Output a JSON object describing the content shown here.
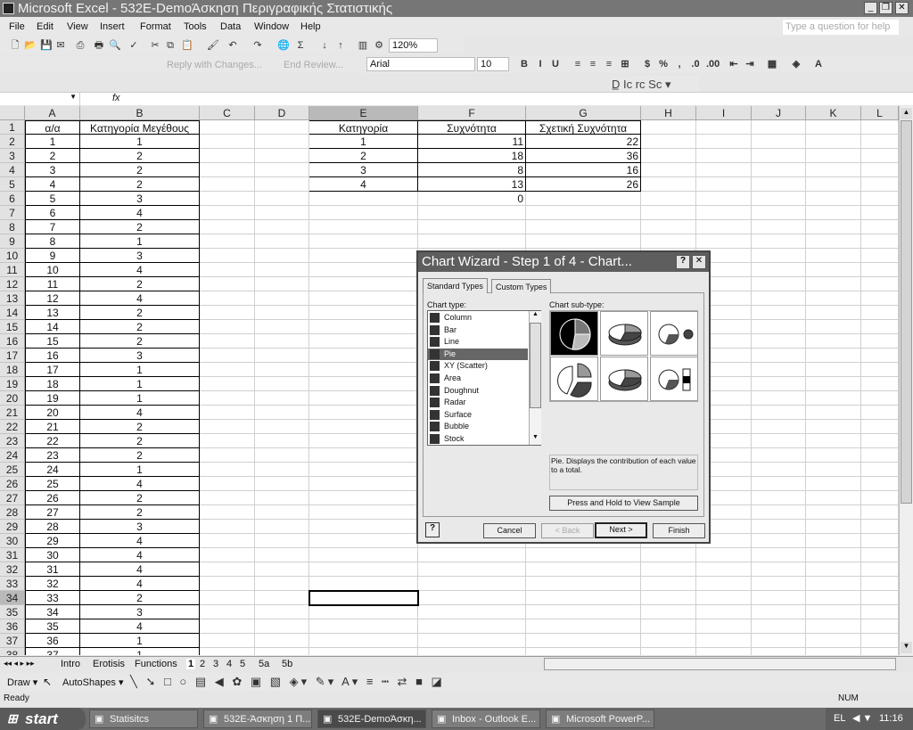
{
  "window": {
    "title": "Microsoft Excel - 532E-DemoΆσκηση Περιγραφικής Στατιστικής"
  },
  "menu": [
    "File",
    "Edit",
    "View",
    "Insert",
    "Format",
    "Tools",
    "Data",
    "Window",
    "Help"
  ],
  "help_placeholder": "Type a question for help",
  "toolbar": {
    "zoom": "120%",
    "reply_label": "Reply with Changes...",
    "end_review_label": "End Review...",
    "font": "Arial",
    "font_size": "10"
  },
  "columns": [
    "A",
    "B",
    "C",
    "D",
    "E",
    "F",
    "G",
    "H",
    "I",
    "J",
    "K",
    "L"
  ],
  "sheet": {
    "A_header": "α/α",
    "B_header": "Κατηγορία Μεγέθους",
    "B_values": [
      1,
      2,
      2,
      2,
      3,
      4,
      2,
      1,
      3,
      4,
      2,
      4,
      2,
      2,
      2,
      3,
      1,
      1,
      1,
      4,
      2,
      2,
      2,
      1,
      4,
      2,
      2,
      3,
      4,
      4,
      4,
      4,
      2,
      3,
      4,
      1,
      1
    ],
    "freq_headers": [
      "Κατηγορία",
      "Συχνότητα",
      "Σχετική Συχνότητα"
    ],
    "freq_rows": [
      [
        1,
        11,
        22
      ],
      [
        2,
        18,
        36
      ],
      [
        3,
        8,
        16
      ],
      [
        4,
        13,
        26
      ]
    ],
    "F6": "0",
    "selected_cell": "E34"
  },
  "sheet_tabs": [
    "Intro",
    "Erotisis",
    "Functions",
    "1",
    "2",
    "3",
    "4",
    "5",
    "5a",
    "5b"
  ],
  "active_tab": "1",
  "drawing": {
    "draw": "Draw",
    "autoshapes": "AutoShapes"
  },
  "status": {
    "left": "Ready",
    "num": "NUM"
  },
  "dialog": {
    "title": "Chart Wizard - Step 1 of 4 - Chart...",
    "tabs": [
      "Standard Types",
      "Custom Types"
    ],
    "chart_type_label": "Chart type:",
    "subtype_label": "Chart sub-type:",
    "chart_types": [
      "Column",
      "Bar",
      "Line",
      "Pie",
      "XY (Scatter)",
      "Area",
      "Doughnut",
      "Radar",
      "Surface",
      "Bubble",
      "Stock"
    ],
    "selected_type": "Pie",
    "description": "Pie. Displays the contribution of each value to a total.",
    "sample_button": "Press and Hold to View Sample",
    "buttons": {
      "cancel": "Cancel",
      "back": "< Back",
      "next": "Next >",
      "finish": "Finish"
    }
  },
  "taskbar": {
    "start": "start",
    "items": [
      "Statisitcs",
      "532E-Άσκηση 1 Π...",
      "532E-DemoΆσκη...",
      "Inbox - Outlook E...",
      "Microsoft PowerP..."
    ],
    "lang": "EL",
    "clock": "11:16"
  }
}
